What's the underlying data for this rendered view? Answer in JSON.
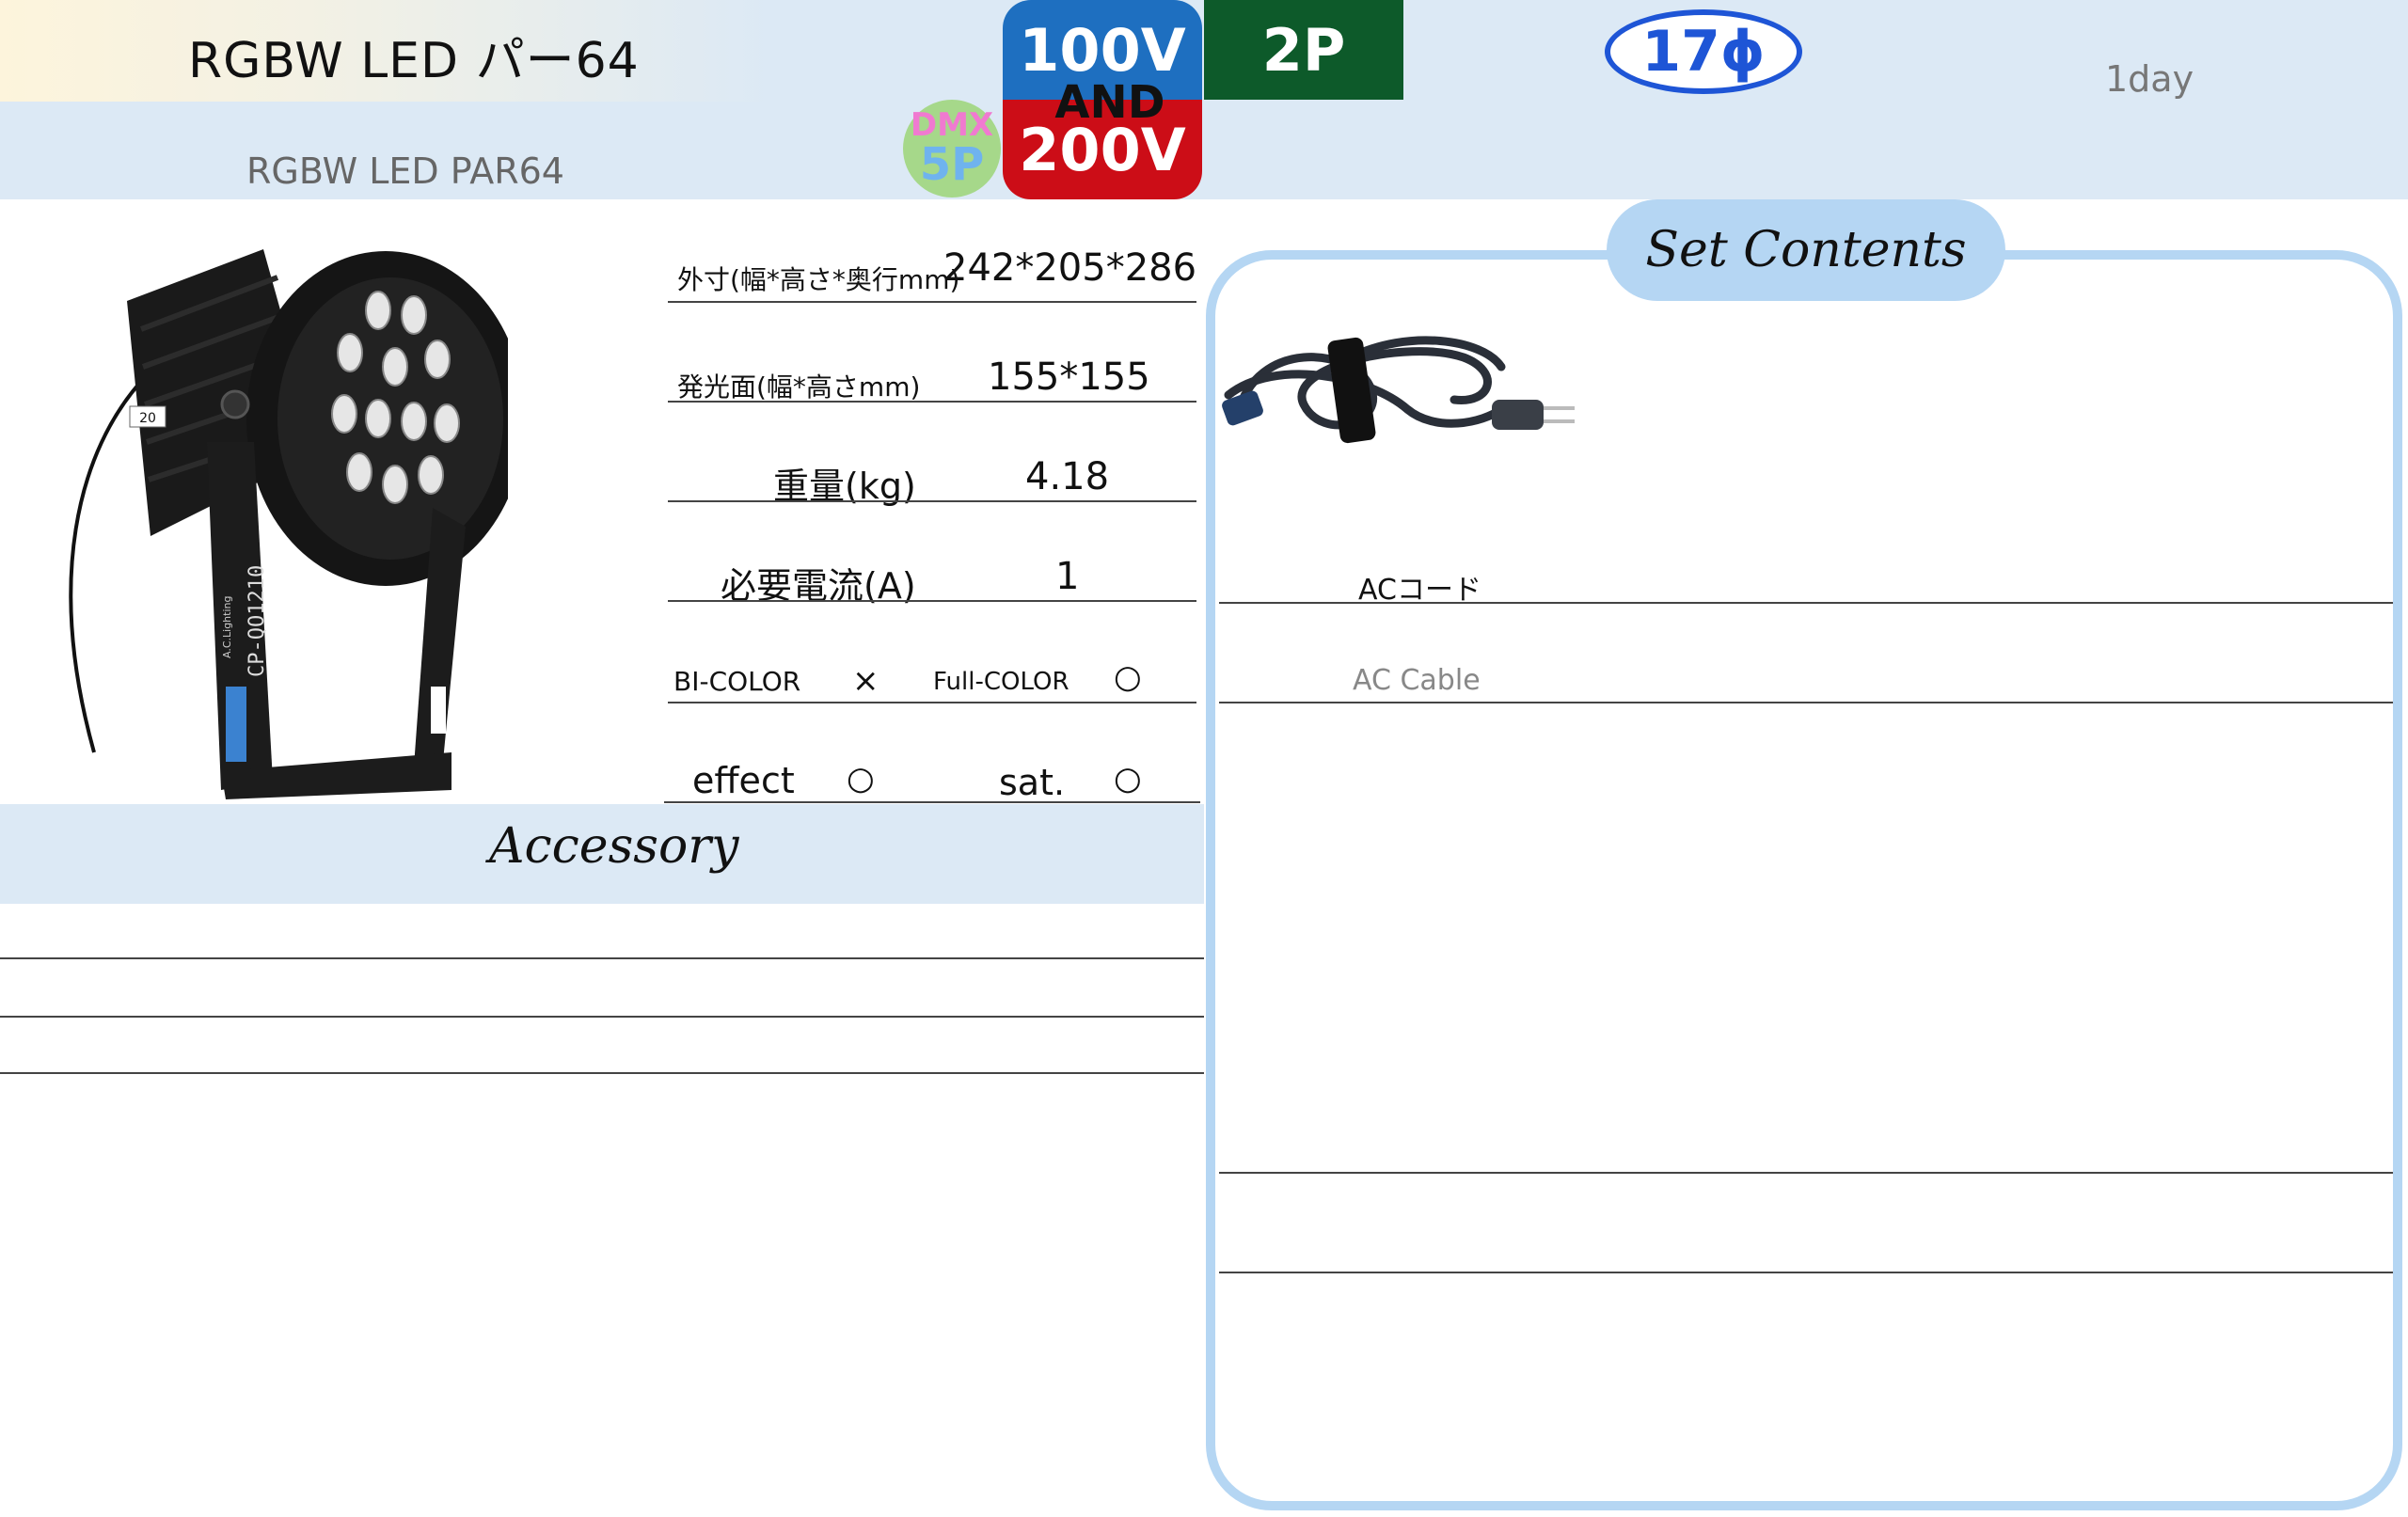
{
  "header": {
    "title_jp": "RGBW LED パー64",
    "title_en": "RGBW LED PAR64",
    "rental_period": "1day"
  },
  "badges": {
    "voltage_100": "100V",
    "and": "AND",
    "voltage_200": "200V",
    "plug": "2P",
    "dmx_top": "DMX",
    "dmx_bottom": "5P",
    "diameter": "17ϕ"
  },
  "specs": {
    "dimensions_label": "外寸(幅*高さ*奥行mm)",
    "dimensions_value": "242*205*286",
    "emitting_label": "発光面(幅*高さmm)",
    "emitting_value": "155*155",
    "weight_label": "重量(kg)",
    "weight_value": "4.18",
    "current_label": "必要電流(A)",
    "current_value": "1",
    "bicolor_label": "BI-COLOR",
    "bicolor_value": "×",
    "fullcolor_label": "Full-COLOR",
    "fullcolor_value": "○",
    "effect_label": "effect",
    "effect_value": "○",
    "sat_label": "sat.",
    "sat_value": "○"
  },
  "product_image": {
    "model_text": "CP-QO1210",
    "brand_text": "A.C.Lighting",
    "tag_text": "20"
  },
  "accessory": {
    "title": "Accessory"
  },
  "set_contents": {
    "title": "Set Contents",
    "items": [
      {
        "name_jp": "ACコード",
        "name_en": "AC Cable",
        "icon": "power-cord-icon"
      }
    ]
  },
  "colors": {
    "band": "#dce9f5",
    "frame": "#b5d6f3",
    "badge_blue": "#1e6fc0",
    "badge_red": "#cc0d17",
    "badge_green": "#0d5a2a",
    "badge_outline": "#1e55d6"
  }
}
